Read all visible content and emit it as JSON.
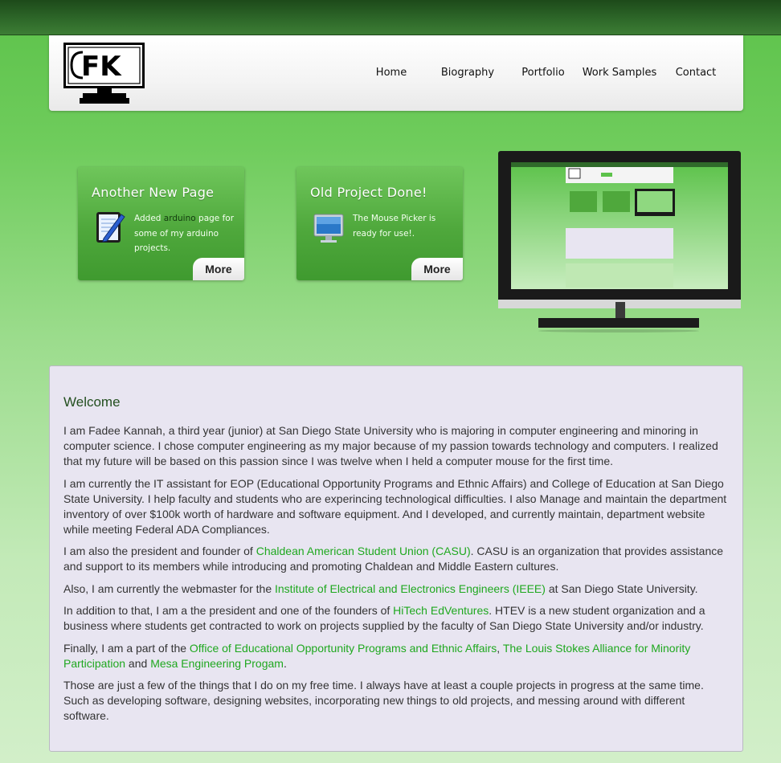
{
  "logo": {
    "text": "FK"
  },
  "nav": {
    "items": [
      "Home",
      "Biography",
      "Portfolio",
      "Work Samples",
      "Contact"
    ]
  },
  "news": [
    {
      "title": "Another New Page",
      "icon": "document-pen-icon",
      "text_before": "Added ",
      "highlight": "arduino",
      "text_after": " page for some of my arduino projects.",
      "more": "More"
    },
    {
      "title": "Old Project Done!",
      "icon": "computer-monitor-icon",
      "text_before": "The Mouse Picker is ready for use!.",
      "highlight": "",
      "text_after": "",
      "more": "More"
    }
  ],
  "welcome": {
    "title": "Welcome",
    "p1": "I am Fadee Kannah, a third year (junior) at San Diego State University who is majoring in computer engineering and minoring in computer science. I chose computer engineering as my major because of my passion towards technology and computers. I realized that my future will be based on this passion since I was twelve when I held a computer mouse for the first time.",
    "p2": "I am currently the IT assistant for EOP (Educational Opportunity Programs and Ethnic Affairs) and College of Education at San Diego State University. I help faculty and students who are experincing technological difficulties. I also Manage and maintain the department inventory of over $100k worth of hardware and software equipment. And I developed, and currently maintain, department website while meeting Federal ADA Compliances.",
    "p3_before": "I am also the president and founder of ",
    "p3_link": "Chaldean American Student Union (CASU)",
    "p3_after": ". CASU is an organization that provides assistance and support to its members while introducing and promoting Chaldean and Middle Eastern cultures.",
    "p4_before": "Also, I am currently the webmaster for the ",
    "p4_link": "Institute of Electrical and Electronics Engineers (IEEE)",
    "p4_after": " at San Diego State University.",
    "p5_before": "In addition to that, I am a the president and one of the founders of ",
    "p5_link": "HiTech EdVentures",
    "p5_after": ". HTEV is a new student organization and a business where students get contracted to work on projects supplied by the faculty of San Diego State University and/or industry.",
    "p6_before": "Finally, I am a part of the ",
    "p6_link1": "Office of Educational Opportunity Programs and Ethnic Affairs",
    "p6_sep": ", ",
    "p6_link2": "The Louis Stokes Alliance for Minority Participation",
    "p6_and": " and ",
    "p6_link3": "Mesa Engineering Progam",
    "p6_after": ".",
    "p7": "Those are just a few of the things that I do on my free time. I always have at least a couple projects in progress at the same time. Such as developing software, designing websites, incorporating new things to old projects, and messing around with different software."
  },
  "colors": {
    "accent_green": "#1fa81f",
    "topbar": "#2f6a2a",
    "content_bg": "#e8e5f1"
  }
}
